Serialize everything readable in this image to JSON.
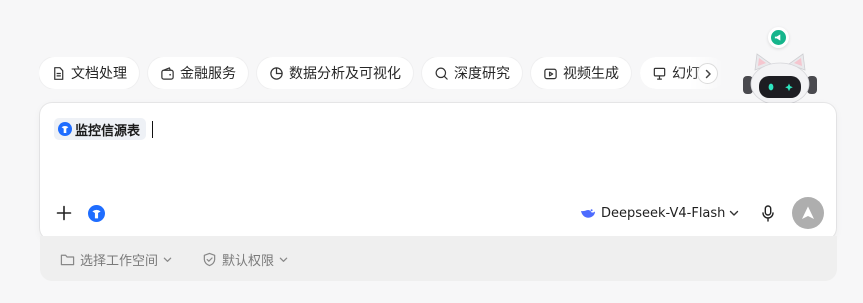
{
  "chips": [
    {
      "label": "文档处理",
      "icon": "document-icon"
    },
    {
      "label": "金融服务",
      "icon": "wallet-icon"
    },
    {
      "label": "数据分析及可视化",
      "icon": "pie-chart-icon"
    },
    {
      "label": "深度研究",
      "icon": "search-icon"
    },
    {
      "label": "视频生成",
      "icon": "video-icon"
    },
    {
      "label": "幻灯片",
      "icon": "presentation-icon"
    }
  ],
  "composer": {
    "tag_label": "监控信源表",
    "input_value": ""
  },
  "toolbar": {
    "model_name": "Deepseek-V4-Flash"
  },
  "footer": {
    "workspace_label": "选择工作空间",
    "permission_label": "默认权限"
  },
  "colors": {
    "accent": "#1f6dff",
    "notify": "#16b58c",
    "send_disabled": "#aeaeae"
  }
}
